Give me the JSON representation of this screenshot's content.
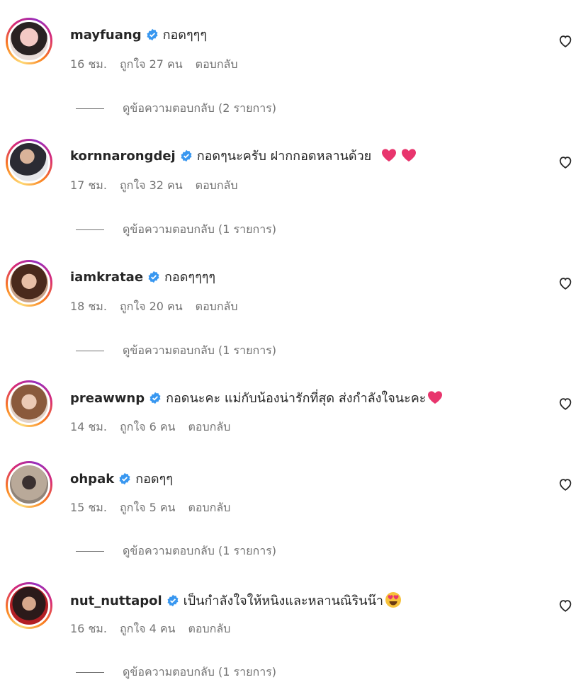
{
  "comments": [
    {
      "username": "mayfuang",
      "text": "กอดๆๆๆ",
      "time": "16 ชม.",
      "likes": "ถูกใจ 27 คน",
      "reply": "ตอบกลับ",
      "view_replies": "ดูข้อความตอบกลับ (2 รายการ)"
    },
    {
      "username": "kornnarongdej",
      "text": "กอดๆนะครับ ฝากกอดหลานด้วย",
      "time": "17 ชม.",
      "likes": "ถูกใจ 32 คน",
      "reply": "ตอบกลับ",
      "view_replies": "ดูข้อความตอบกลับ (1 รายการ)"
    },
    {
      "username": "iamkratae",
      "text": "กอดๆๆๆๆ",
      "time": "18 ชม.",
      "likes": "ถูกใจ 20 คน",
      "reply": "ตอบกลับ",
      "view_replies": "ดูข้อความตอบกลับ (1 รายการ)"
    },
    {
      "username": "preawwnp",
      "text": "กอดนะคะ แม่กับน้องน่ารักที่สุด ส่งกำลังใจนะคะ",
      "time": "14 ชม.",
      "likes": "ถูกใจ 6 คน",
      "reply": "ตอบกลับ"
    },
    {
      "username": "ohpak",
      "text": "กอดๆๆ",
      "time": "15 ชม.",
      "likes": "ถูกใจ 5 คน",
      "reply": "ตอบกลับ",
      "view_replies": "ดูข้อความตอบกลับ (1 รายการ)"
    },
    {
      "username": "nut_nuttapol",
      "text": "เป็นกำลังใจให้หนิงและหลานณิรินน๊า",
      "time": "16 ชม.",
      "likes": "ถูกใจ 4 คน",
      "reply": "ตอบกลับ",
      "view_replies": "ดูข้อความตอบกลับ (1 รายการ)"
    }
  ],
  "icons": {
    "verified": "verified-badge-icon",
    "like": "heart-outline-icon"
  },
  "colors": {
    "verified": "#3897f0",
    "meta": "#737373",
    "emoji_heart": "#e8356d"
  }
}
